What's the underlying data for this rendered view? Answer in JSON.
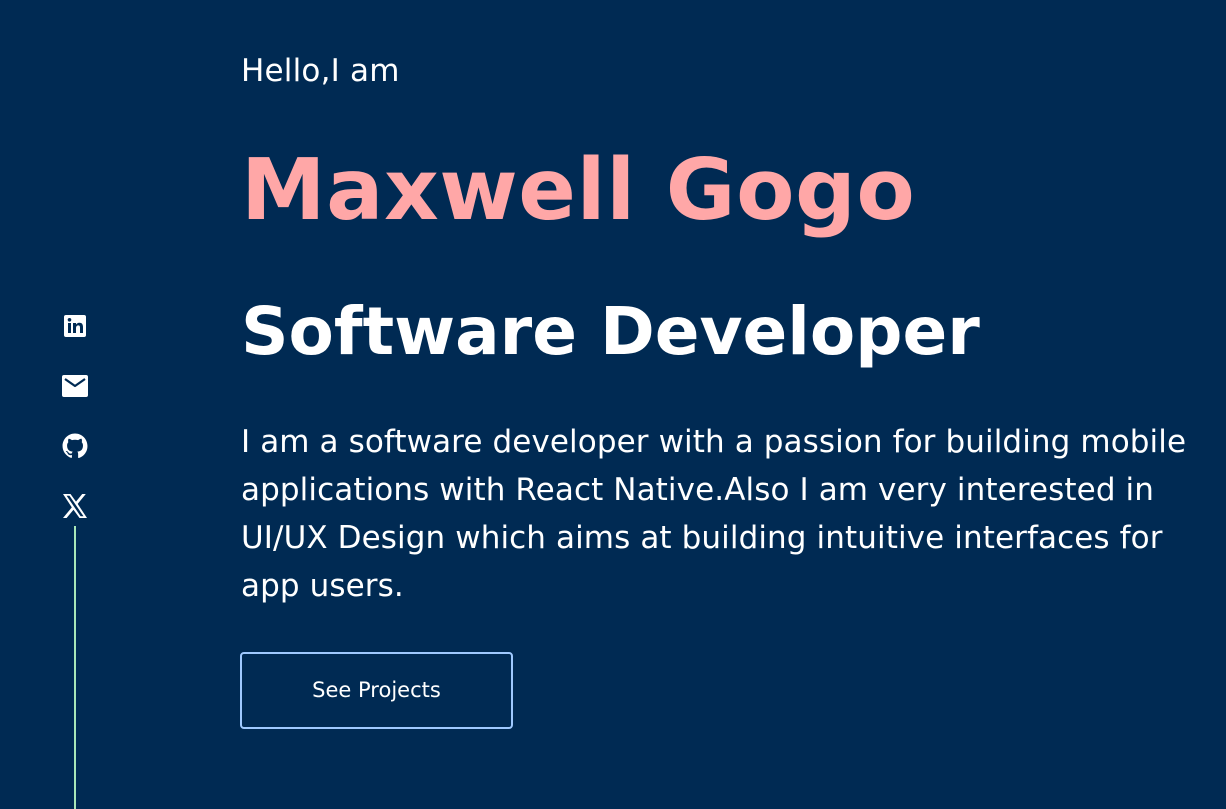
{
  "hero": {
    "greeting": "Hello,I am",
    "name": "Maxwell Gogo",
    "role": "Software Developer",
    "bio": "I am a software developer with a passion for building mobile applications with React Native.Also I am very interested in UI/UX Design which aims at building intuitive interfaces for app users.",
    "cta_label": "See Projects"
  },
  "social": {
    "icons": [
      "linkedin-icon",
      "mail-icon",
      "github-icon",
      "x-icon"
    ]
  },
  "colors": {
    "background": "#002a53",
    "name": "#ffa7a7",
    "text": "#ffffff",
    "button_border": "#9fc9ff",
    "rail_line": "#a8e6b8"
  }
}
